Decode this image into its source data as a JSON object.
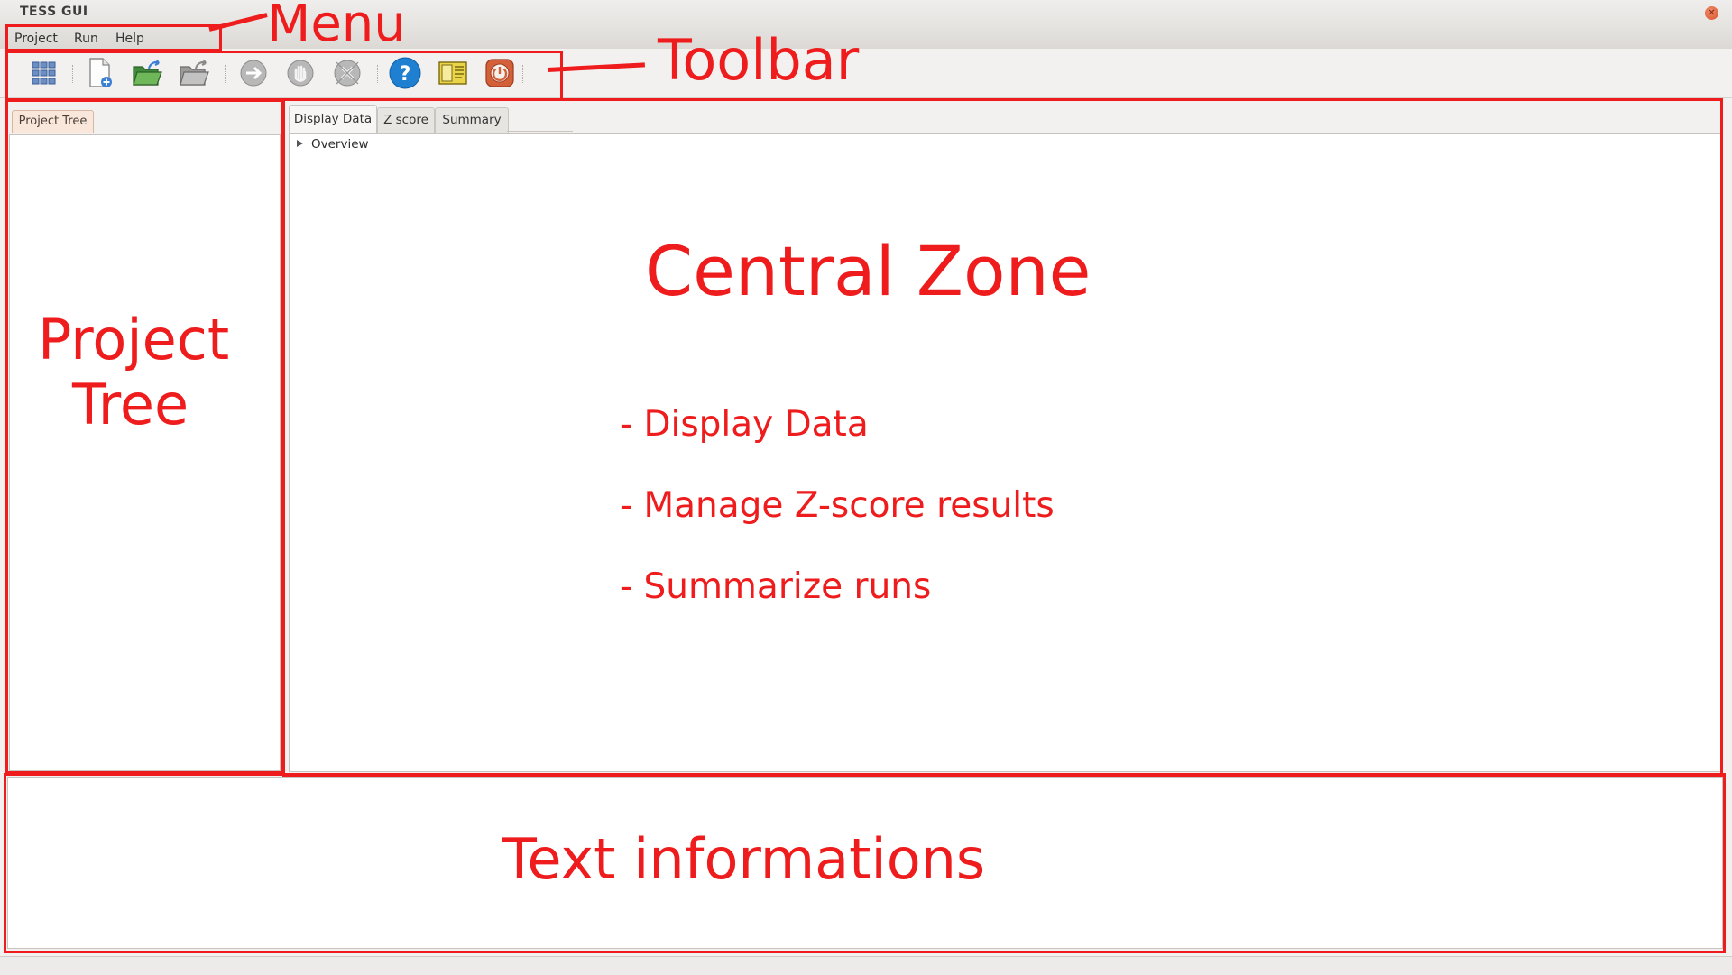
{
  "window": {
    "title": "TESS GUI"
  },
  "menu": [
    "Project",
    "Run",
    "Help"
  ],
  "toolbar": {
    "icons": [
      "grid-icon",
      "new-file-icon",
      "open-project-icon",
      "reopen-icon",
      "run-arrow-icon",
      "stop-hand-icon",
      "cancel-x-icon",
      "help-icon",
      "manual-icon",
      "quit-icon"
    ]
  },
  "left_panel": {
    "tab_label": "Project Tree"
  },
  "central": {
    "tabs": [
      "Display Data",
      "Z score",
      "Summary"
    ],
    "active_tab": "Display Data",
    "tree_row": "Overview"
  },
  "annotations": {
    "menu": "Menu",
    "toolbar": "Toolbar",
    "project_tree_line1": "Project",
    "project_tree_line2": "Tree",
    "central_zone": "Central Zone",
    "bullets": [
      "- Display Data",
      "- Manage Z-score results",
      "- Summarize runs"
    ],
    "text_info": "Text informations",
    "color": "#ee1c1c"
  }
}
